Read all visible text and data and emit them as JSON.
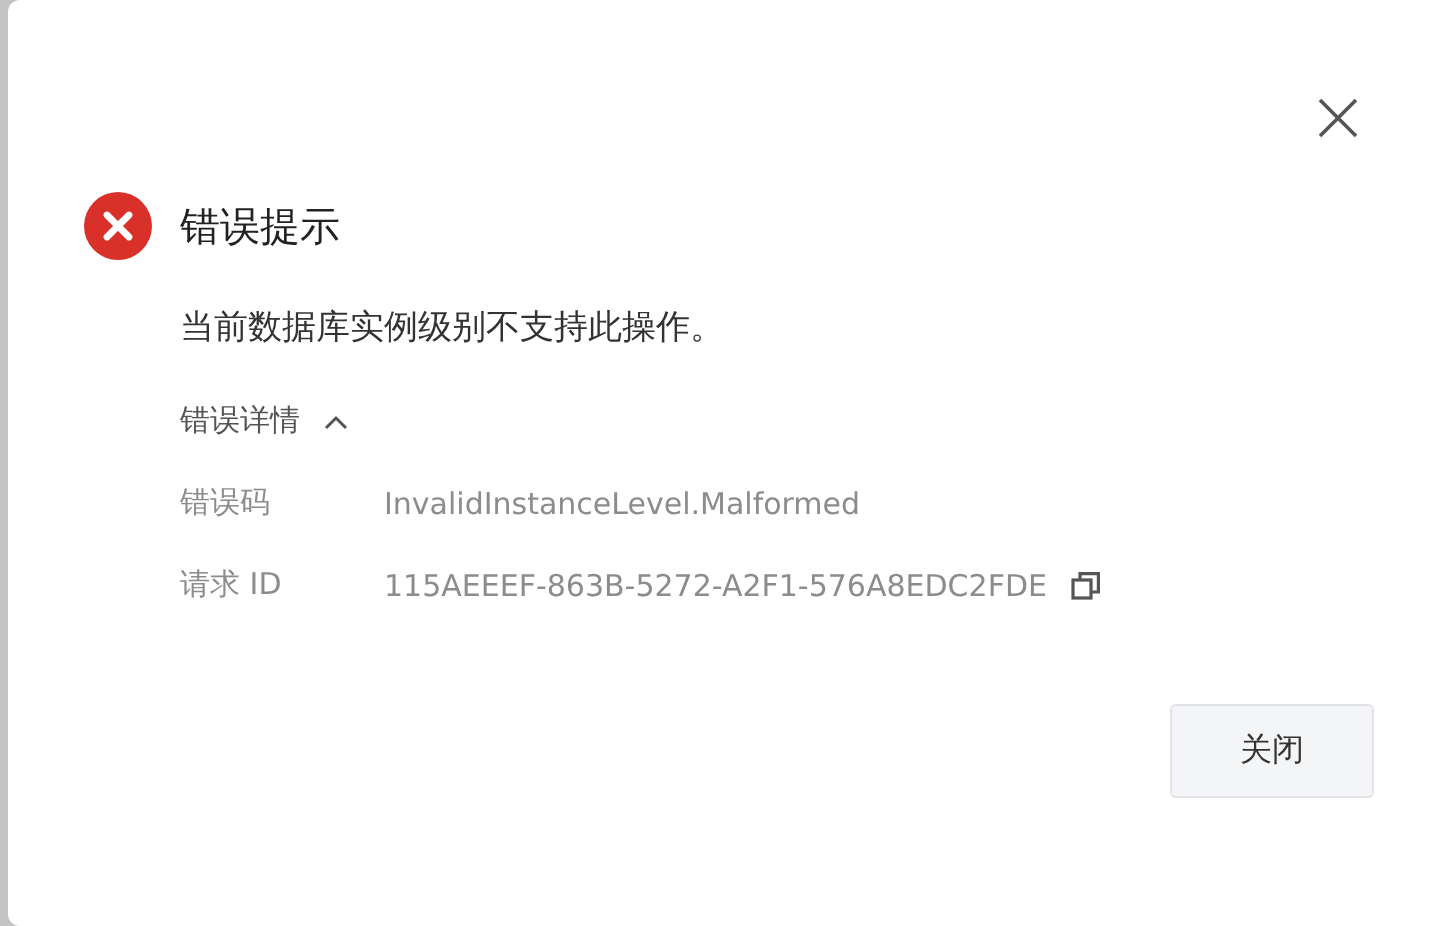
{
  "dialog": {
    "title": "错误提示",
    "message": "当前数据库实例级别不支持此操作。",
    "details": {
      "label": "错误详情",
      "expanded": true,
      "rows": [
        {
          "label": "错误码",
          "value": "InvalidInstanceLevel.Malformed",
          "copyable": false
        },
        {
          "label": "请求 ID",
          "value": "115AEEEF-863B-5272-A2F1-576A8EDC2FDE",
          "copyable": true
        }
      ]
    },
    "buttons": [
      "关闭"
    ]
  }
}
